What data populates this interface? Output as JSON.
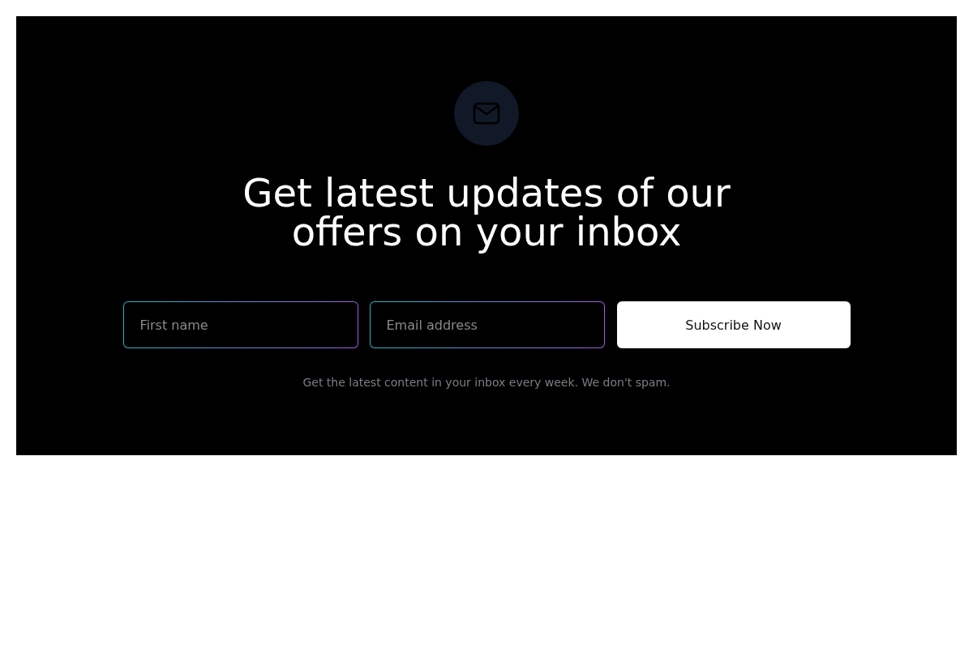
{
  "heading": "Get latest updates of our offers on your inbox",
  "fields": [
    {
      "placeholder": "First name"
    },
    {
      "placeholder": "Email address"
    }
  ],
  "button": "Subscribe Now",
  "note": "Get the latest content in your inbox every week. We don't spam."
}
